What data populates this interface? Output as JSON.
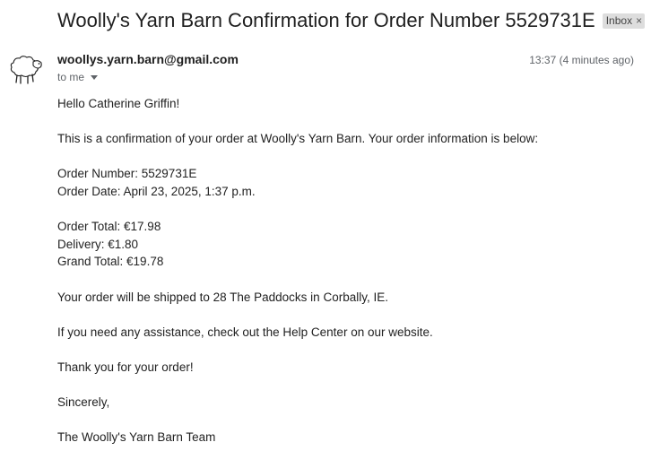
{
  "email": {
    "subject": "Woolly's Yarn Barn Confirmation for Order Number 5529731E",
    "label": "Inbox",
    "label_close": "×",
    "sender": "woollys.yarn.barn@gmail.com",
    "recipient": "to me",
    "timestamp": "13:37 (4 minutes ago)",
    "avatar_icon": "sheep-icon"
  },
  "body": {
    "greeting": "Hello Catherine Griffin!",
    "intro": "This is a confirmation of your order at Woolly's Yarn Barn. Your order information is below:",
    "order_number": "Order Number: 5529731E",
    "order_date": "Order Date: April 23, 2025, 1:37 p.m.",
    "order_total": "Order Total: €17.98",
    "delivery": "Delivery: €1.80",
    "grand_total": "Grand Total: €19.78",
    "shipping": "Your order will be shipped to 28 The Paddocks in Corbally, IE.",
    "help": "If you need any assistance, check out the Help Center on our website.",
    "thanks": "Thank you for your order!",
    "closing": "Sincerely,",
    "signature": "The Woolly's Yarn Barn Team"
  }
}
